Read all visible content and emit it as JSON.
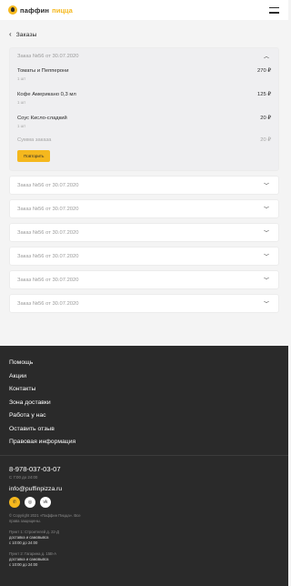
{
  "header": {
    "brand_main": "паффин",
    "brand_accent": "пицца"
  },
  "back": {
    "label": "Заказы"
  },
  "open_order": {
    "title": "Заказ №56 от 30.07.2020",
    "items": [
      {
        "name": "Томаты и Пепперони",
        "qty": "1 шт",
        "price": "270 ₽"
      },
      {
        "name": "Кофе Американо 0,3 мл",
        "qty": "1 шт",
        "price": "125 ₽"
      },
      {
        "name": "Соус Кисло-сладкий",
        "qty": "1 шт",
        "price": "20 ₽"
      }
    ],
    "total_label": "Сумма заказа",
    "total_value": "20 ₽",
    "repeat_label": "Повторить"
  },
  "orders": [
    {
      "title": "Заказ №56 от 30.07.2020"
    },
    {
      "title": "Заказ №56 от 30.07.2020"
    },
    {
      "title": "Заказ №56 от 30.07.2020"
    },
    {
      "title": "Заказ №56 от 30.07.2020"
    },
    {
      "title": "Заказ №56 от 30.07.2020"
    },
    {
      "title": "Заказ №56 от 30.07.2020"
    }
  ],
  "footer": {
    "menu": [
      "Помощь",
      "Акции",
      "Контакты",
      "Зона доставки",
      "Работа у нас",
      "Оставить отзыв",
      "Правовая информация"
    ],
    "phone": "8-978-037-03-07",
    "hours": "С 7:00 до 24:00",
    "email": "info@puffinpizza.ru",
    "copyright": "© Copyright 2021 «Паффин Пицца». Все права защищены.",
    "addresses": [
      {
        "line1": "Пункт 1: Строителей д. 22-Д",
        "line2": "доставка и самовывоз",
        "line3": "с 10:00 до 24:00"
      },
      {
        "line1": "Пункт 2: Гагарина д. 15В-А",
        "line2": "доставка и самовывоз",
        "line3": "с 10:00 до 24:00"
      }
    ]
  },
  "colors": {
    "accent": "#f5b81e",
    "footer_bg": "#2a2a2a",
    "page_bg": "#f4f4f4"
  }
}
